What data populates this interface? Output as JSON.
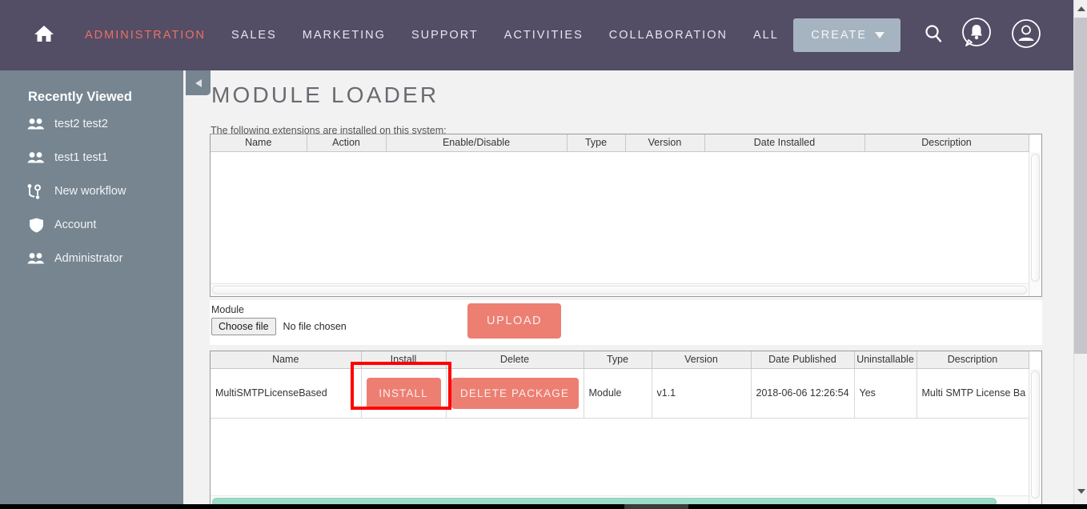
{
  "nav": {
    "home_icon": "home-icon",
    "links": [
      {
        "label": "ADMINISTRATION",
        "active": true
      },
      {
        "label": "SALES",
        "active": false
      },
      {
        "label": "MARKETING",
        "active": false
      },
      {
        "label": "SUPPORT",
        "active": false
      },
      {
        "label": "ACTIVITIES",
        "active": false
      },
      {
        "label": "COLLABORATION",
        "active": false
      },
      {
        "label": "ALL",
        "active": false
      }
    ],
    "create_label": "CREATE",
    "search_icon": "search-icon",
    "notifications_icon": "bell-notification-icon",
    "profile_icon": "user-profile-icon",
    "bar_color": "#534d66",
    "active_color": "#ec7063",
    "create_bg": "#a6b4c1"
  },
  "sidebar": {
    "title": "Recently Viewed",
    "bg_color": "#768590",
    "items": [
      {
        "label": "test2 test2",
        "icon": "contacts-icon"
      },
      {
        "label": "test1 test1",
        "icon": "contacts-icon"
      },
      {
        "label": "New workflow",
        "icon": "workflow-icon"
      },
      {
        "label": "Account",
        "icon": "shield-icon"
      },
      {
        "label": "Administrator",
        "icon": "contacts-icon"
      }
    ]
  },
  "main": {
    "collapse_icon": "collapse-sidebar-icon",
    "title": "MODULE LOADER",
    "subtitle": "The following extensions are installed on this system:",
    "installed_table": {
      "columns": [
        "Name",
        "Action",
        "Enable/Disable",
        "Type",
        "Version",
        "Date Installed",
        "Description"
      ],
      "rows": []
    },
    "upload": {
      "module_label": "Module",
      "choose_file_label": "Choose file",
      "no_file_text": "No file chosen",
      "upload_button_label": "UPLOAD"
    },
    "available_table": {
      "columns": [
        "Name",
        "Install",
        "Delete",
        "Type",
        "Version",
        "Date Published",
        "Uninstallable",
        "Description"
      ],
      "rows": [
        {
          "name": "MultiSMTPLicenseBased",
          "install_label": "INSTALL",
          "delete_label": "DELETE PACKAGE",
          "type": "Module",
          "version": "v1.1",
          "date_published": "2018-06-06 12:26:54",
          "uninstallable": "Yes",
          "description": "Multi SMTP License Ba"
        }
      ]
    },
    "highlight": {
      "target": "install-button",
      "color": "#ff0000"
    },
    "button_color": "#ec7f72",
    "scrollbar_accent": "#9bdbc8"
  }
}
